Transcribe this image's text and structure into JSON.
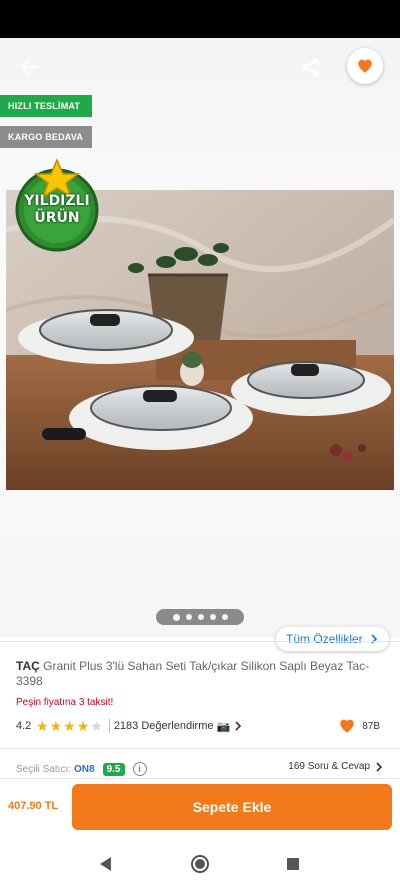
{
  "header": {
    "back_icon": "arrow-left-icon",
    "share_icon": "share-icon",
    "favorite_icon": "heart-icon"
  },
  "badges": {
    "fast_delivery": "HIZLI TESLİMAT",
    "free_cargo": "KARGO BEDAVA",
    "star_product": "YILDIZLI ÜRÜN"
  },
  "gallery": {
    "image_count": 5,
    "active_index": 0,
    "all_features_label": "Tüm Özellikler"
  },
  "product": {
    "brand": "TAÇ",
    "title": "Granit Plus 3'lü Sahan Seti Tak/çıkar Silikon Saplı Beyaz Tac-3398",
    "installment_text": "Peşin fiyatına 3 taksit!",
    "rating": "4.2",
    "rating_stars": 4,
    "rating_max": 5,
    "reviews_text": "2183 Değerlendirme",
    "favorites_count": "87B"
  },
  "seller": {
    "label": "Seçili Satıcı:",
    "name": "ON8",
    "score": "9.5",
    "qa_text": "169 Soru & Cevap"
  },
  "purchase": {
    "price": "407.90 TL",
    "add_to_cart_label": "Sepete Ekle"
  },
  "colors": {
    "accent": "#f27a1a",
    "success": "#21a84a",
    "link": "#1a73e8"
  }
}
